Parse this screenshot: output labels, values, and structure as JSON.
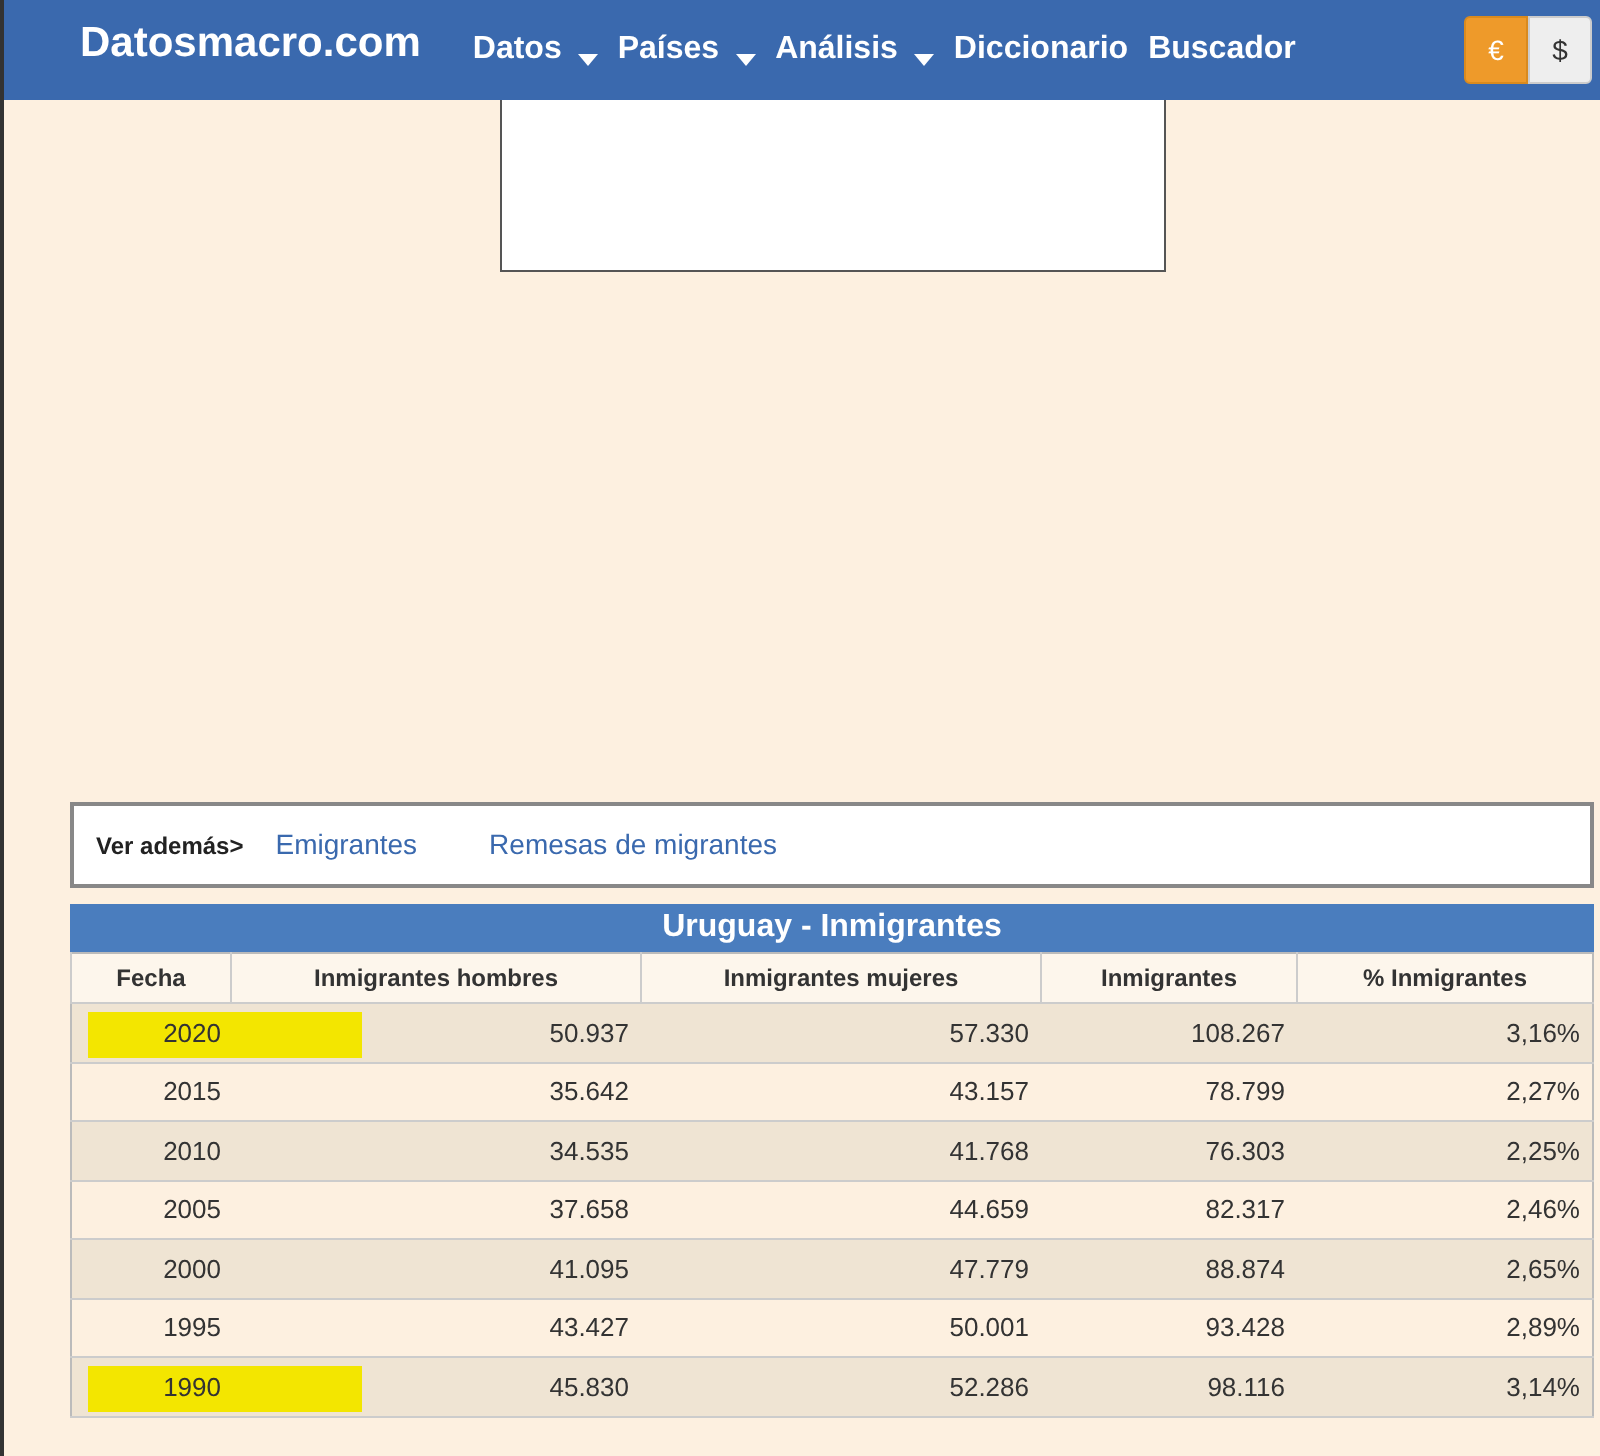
{
  "navbar": {
    "brand": "Datosmacro.com",
    "menu": [
      {
        "label": "Datos",
        "dropdown": true
      },
      {
        "label": "Países",
        "dropdown": true
      },
      {
        "label": "Análisis",
        "dropdown": true
      },
      {
        "label": "Diccionario",
        "dropdown": false
      },
      {
        "label": "Buscador",
        "dropdown": false
      }
    ],
    "currency": [
      {
        "label": "€",
        "selected": true
      },
      {
        "label": "$",
        "selected": false
      }
    ]
  },
  "see_also": {
    "label": "Ver además>",
    "links": [
      "Emigrantes",
      "Remesas de migrantes"
    ]
  },
  "table": {
    "title": "Uruguay - Inmigrantes",
    "columns": [
      "Fecha",
      "Inmigrantes hombres",
      "Inmigrantes mujeres",
      "Inmigrantes",
      "% Inmigrantes"
    ],
    "rows": [
      {
        "cells": [
          "2020",
          "50.937",
          "57.330",
          "108.267",
          "3,16%"
        ],
        "highlighted": true
      },
      {
        "cells": [
          "2015",
          "35.642",
          "43.157",
          "78.799",
          "2,27%"
        ],
        "highlighted": false
      },
      {
        "cells": [
          "2010",
          "34.535",
          "41.768",
          "76.303",
          "2,25%"
        ],
        "highlighted": false
      },
      {
        "cells": [
          "2005",
          "37.658",
          "44.659",
          "82.317",
          "2,46%"
        ],
        "highlighted": false
      },
      {
        "cells": [
          "2000",
          "41.095",
          "47.779",
          "88.874",
          "2,65%"
        ],
        "highlighted": false
      },
      {
        "cells": [
          "1995",
          "43.427",
          "50.001",
          "93.428",
          "2,89%"
        ],
        "highlighted": false
      },
      {
        "cells": [
          "1990",
          "45.830",
          "52.286",
          "98.116",
          "3,14%"
        ],
        "highlighted": true
      }
    ]
  }
}
